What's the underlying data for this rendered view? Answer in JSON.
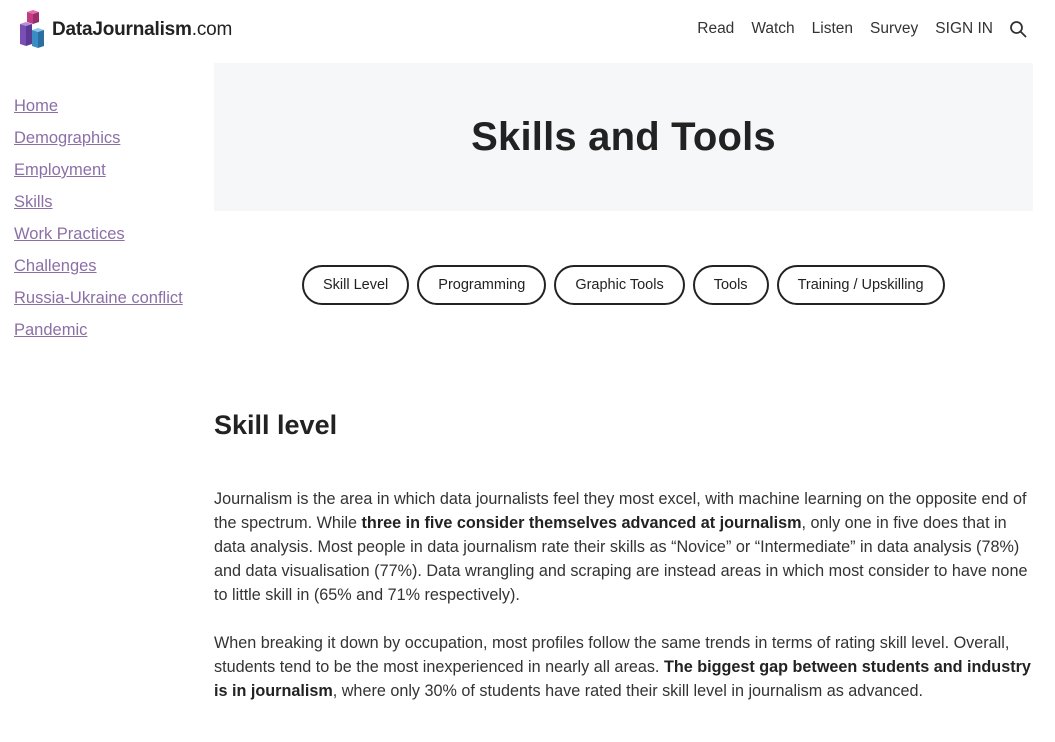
{
  "header": {
    "logo": {
      "brand_bold": "DataJournalism",
      "brand_suffix": ".com",
      "icon": "stacked-cubes-logo"
    },
    "nav": [
      {
        "label": "Read"
      },
      {
        "label": "Watch"
      },
      {
        "label": "Listen"
      },
      {
        "label": "Survey"
      },
      {
        "label": "SIGN IN"
      }
    ],
    "search_icon": "search-icon"
  },
  "sidebar": {
    "items": [
      {
        "label": "Home"
      },
      {
        "label": "Demographics"
      },
      {
        "label": "Employment"
      },
      {
        "label": "Skills"
      },
      {
        "label": "Work Practices"
      },
      {
        "label": "Challenges"
      },
      {
        "label": "Russia-Ukraine conflict"
      },
      {
        "label": "Pandemic"
      }
    ],
    "link_color": "#8c6fa6"
  },
  "hero": {
    "title": "Skills and Tools"
  },
  "tabs": [
    {
      "label": "Skill Level"
    },
    {
      "label": "Programming"
    },
    {
      "label": "Graphic Tools"
    },
    {
      "label": "Tools"
    },
    {
      "label": "Training / Upskilling"
    }
  ],
  "section": {
    "title": "Skill level",
    "p1": {
      "a": "Journalism is the area in which data journalists feel they most excel, with machine learning on the opposite end of the spectrum. While ",
      "b": "three in five consider themselves advanced at journalism",
      "c": ", only one in five does that in data analysis. Most people in data journalism rate their skills as “Novice” or “Intermediate” in data analysis (78%) and data visualisation (77%). Data wrangling and scraping are instead areas in which most consider to have none to little skill in (65% and 71% respectively)."
    },
    "p2": {
      "a": "When breaking it down by occupation, most profiles follow the same trends in terms of rating skill level. Overall, students tend to be the most inexperienced in nearly all areas. ",
      "b": "The biggest gap between students and industry is in journalism",
      "c": ", where only 30% of students have rated their skill level in journalism as advanced."
    }
  }
}
